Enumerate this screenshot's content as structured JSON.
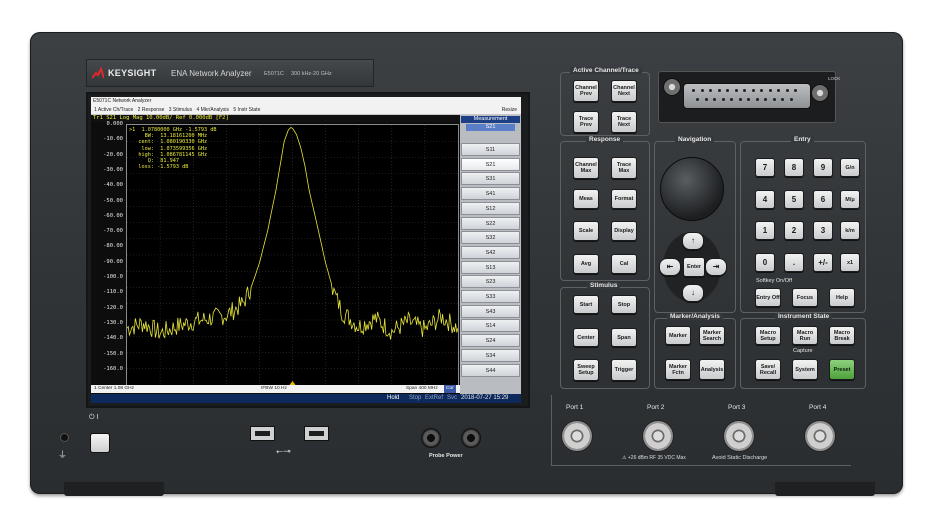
{
  "brand": {
    "name": "KEYSIGHT",
    "product": "ENA Network Analyzer",
    "model": "E5071C",
    "range": "300 kHz-20 GHz"
  },
  "screen": {
    "window_title": "E5071C Network Analyzer",
    "menu": [
      "1 Active Ch/Trace",
      "2 Response",
      "3 Stimulus",
      "4 Mkr/Analysis",
      "5 Instr State"
    ],
    "resize_label": "Resize",
    "trace_header": "Tr1 S21 Log Mag 10.00dB/ Ref 0.000dB [F2]",
    "y_ticks": [
      "0.000",
      "-10.00",
      "-20.00",
      "-30.00",
      "-40.00",
      "-50.00",
      "-60.00",
      "-70.00",
      "-80.00",
      "-90.00",
      "-100.0",
      "-110.0",
      "-120.0",
      "-130.0",
      "-140.0",
      "-150.0",
      "-160.0"
    ],
    "marker_readout": [
      ">1  1.0780000 GHz -1.5793 dB",
      "     BW:  13.18161200 MHz",
      "   cent:  1.080190330 GHz",
      "    low:  1.073599356 GHz",
      "   high:  1.086781145 GHz",
      "      Q:  81.947",
      "   loss: -1.5793 dB"
    ],
    "marker_label": "1",
    "bottom_center": "1  Center 1.08 GHz",
    "bottom_ifbw": "IFBW 10 Hz",
    "bottom_span": "Span 400 MHz",
    "bottom_cor": "Cor",
    "status": {
      "hold": "Hold",
      "stop": "Stop",
      "extref": "ExtRef",
      "svc": "Svc",
      "datetime": "2018-07-27 15:29"
    },
    "measurement": {
      "title": "Measurement",
      "current": "S21",
      "items": [
        "S11",
        "S21",
        "S31",
        "S41",
        "S12",
        "S22",
        "S32",
        "S42",
        "S13",
        "S23",
        "S33",
        "S43",
        "S14",
        "S24",
        "S34",
        "S44"
      ],
      "selected_index": 1
    }
  },
  "panels": {
    "active_channel": {
      "title": "Active Channel/Trace",
      "keys": [
        "Channel Prev",
        "Channel Next",
        "Trace Prev",
        "Trace Next"
      ]
    },
    "response": {
      "title": "Response",
      "keys": [
        "Channel Max",
        "Trace Max",
        "Meas",
        "Format",
        "Scale",
        "Display",
        "Avg",
        "Cal"
      ]
    },
    "stimulus": {
      "title": "Stimulus",
      "keys": [
        "Start",
        "Stop",
        "Center",
        "Span",
        "Sweep Setup",
        "Trigger"
      ]
    },
    "navigation": {
      "title": "Navigation",
      "enter": "Enter",
      "arrows": [
        "↑",
        "↓",
        "⇤",
        "⇥"
      ]
    },
    "marker_analysis": {
      "title": "Marker/Analysis",
      "keys": [
        "Marker",
        "Marker Search",
        "Marker Fctn",
        "Analysis"
      ]
    },
    "entry": {
      "title": "Entry",
      "keys": [
        "7",
        "8",
        "9",
        "G/n",
        "4",
        "5",
        "6",
        "M/μ",
        "1",
        "2",
        "3",
        "k/m",
        "0",
        ".",
        "+/-",
        "x1"
      ],
      "softkey": "Softkey On/Off",
      "entry_off": "Entry Off",
      "focus": "Focus",
      "help": "Help"
    },
    "instrument_state": {
      "title": "Instrument State",
      "keys": [
        "Macro Setup",
        "Macro Run",
        "Macro Break"
      ],
      "capture": "Capture",
      "keys2": [
        "Save/ Recall",
        "System",
        "Preset"
      ]
    }
  },
  "front": {
    "ports": [
      "Port 1",
      "Port 2",
      "Port 3",
      "Port 4"
    ],
    "warning": "⚠ +26 dBm RF  35 VDC Max",
    "static": "Avoid Static Discharge",
    "probe_power": "Probe Power",
    "power_label": "⏻ I",
    "lock": "LOCK"
  },
  "colors": {
    "trace": "#e6e63a",
    "chassis": "#33373a",
    "status_bg": "#0e2a5c",
    "preset": "#5fb24a"
  },
  "chart_data": {
    "type": "line",
    "x_range_ghz": [
      0.88,
      1.28
    ],
    "ylim": [
      -160,
      0
    ],
    "ylabel_unit": "dB",
    "series": [
      {
        "x": [
          0.88,
          0.9,
          0.92,
          0.94,
          0.96,
          0.98,
          1.0,
          1.02,
          1.03,
          1.04,
          1.05,
          1.06,
          1.065,
          1.07,
          1.075,
          1.078,
          1.08,
          1.085,
          1.09,
          1.095,
          1.1,
          1.11,
          1.12,
          1.13,
          1.14,
          1.16,
          1.18,
          1.2,
          1.22,
          1.24,
          1.26,
          1.28
        ],
        "values": [
          -125,
          -122,
          -128,
          -124,
          -121,
          -119,
          -117,
          -110,
          -100,
          -85,
          -65,
          -40,
          -25,
          -10,
          -3,
          -1.58,
          -2,
          -6,
          -14,
          -25,
          -40,
          -62,
          -85,
          -103,
          -115,
          -124,
          -119,
          -127,
          -121,
          -126,
          -118,
          -125
        ]
      }
    ]
  }
}
